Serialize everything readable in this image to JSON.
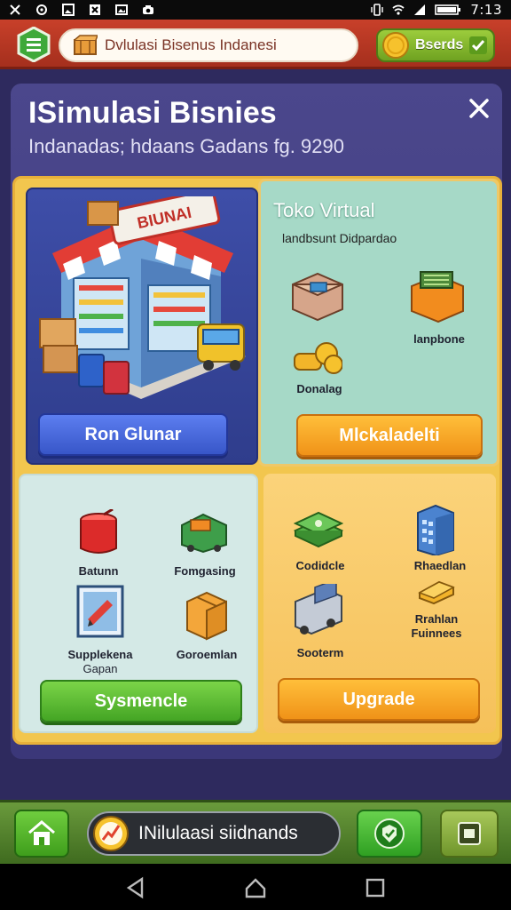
{
  "status_bar": {
    "time": "7:13",
    "icons": [
      "notification-icon",
      "sync-icon",
      "image-icon",
      "close-icon",
      "gallery-icon",
      "camera-icon",
      "vibrate-icon",
      "wifi-icon",
      "signal-icon",
      "battery-icon"
    ]
  },
  "top_bar": {
    "title": "Dvlulasi Bisenus Indanesi",
    "coins_label": "Bserds"
  },
  "panel": {
    "title": "ISimulasi Bisnies",
    "subtitle": "Indanadas; hdaans Gadans fg. 9290"
  },
  "shop_card": {
    "sign_text": "BIUNAI",
    "button_label": "Ron Glunar"
  },
  "virtual_card": {
    "title": "Toko Virtual",
    "subtitle": "landbsunt Didpardao",
    "items": [
      {
        "label": "",
        "icon": "storage-box-icon"
      },
      {
        "label": "lanpbone",
        "icon": "orange-crate-icon"
      },
      {
        "label": "Donalag",
        "icon": "gold-coins-icon"
      }
    ],
    "button_label": "Mlckaladelti"
  },
  "ops_card": {
    "items": [
      {
        "label": "Batunn",
        "icon": "red-barrel-icon"
      },
      {
        "label": "Fomgasing",
        "icon": "cargo-box-icon"
      },
      {
        "label": "Supplekena",
        "label2": "Gapan",
        "icon": "supply-frame-icon"
      },
      {
        "label": "Goroemlan",
        "icon": "package-icon"
      }
    ],
    "button_label": "Sysmencle"
  },
  "upgrade_card": {
    "items": [
      {
        "label": "Codidcle",
        "icon": "cash-stack-icon"
      },
      {
        "label": "Rhaedlan",
        "icon": "building-icon"
      },
      {
        "label": "Sooterm",
        "icon": "delivery-truck-icon"
      },
      {
        "label": "Rrahlan",
        "label2": "Fuinnees",
        "icon": "gold-bar-icon"
      }
    ],
    "button_label": "Upgrade"
  },
  "bottom_bar": {
    "sim_label": "INilulaasi siidnands"
  },
  "colors": {
    "header_red": "#c8402a",
    "panel_purple": "#3b3779",
    "frame_gold": "#f2c64e",
    "accent_green": "#44a524",
    "accent_orange": "#f09318",
    "accent_blue": "#3856c8"
  }
}
